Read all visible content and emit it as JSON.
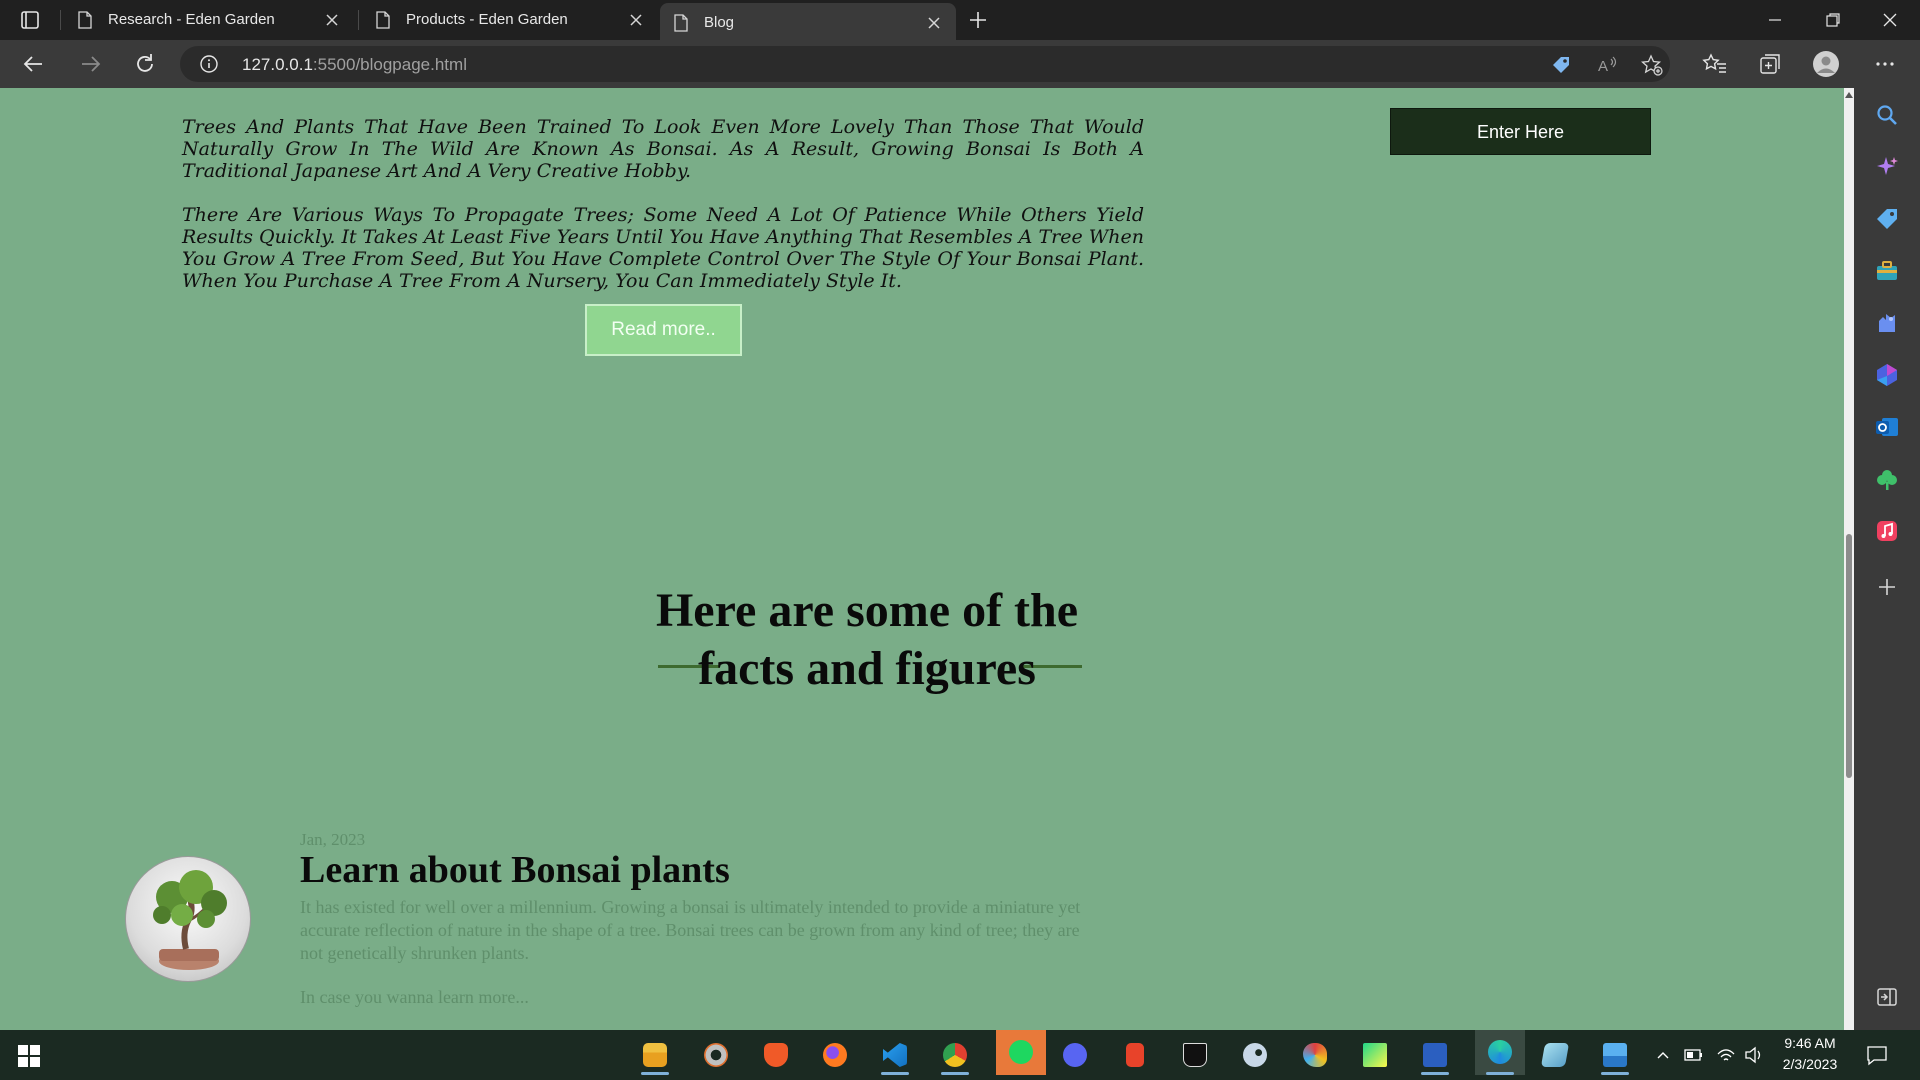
{
  "browser": {
    "tabs": [
      {
        "title": "Research - Eden Garden",
        "active": false
      },
      {
        "title": "Products - Eden Garden",
        "active": false
      },
      {
        "title": "Blog",
        "active": true
      }
    ],
    "address": {
      "host": "127.0.0.1",
      "rest": ":5500/blogpage.html"
    }
  },
  "page": {
    "intro_paragraphs": [
      "Trees And Plants That Have Been Trained To Look Even More Lovely Than Those That Would Naturally Grow In The Wild Are Known As Bonsai. As A Result, Growing Bonsai Is Both A Traditional Japanese Art And A Very Creative Hobby.",
      "There Are Various Ways To Propagate Trees; Some Need A Lot Of Patience While Others Yield Results Quickly. It Takes At Least Five Years Until You Have Anything That Resembles A Tree When You Grow A Tree From Seed, But You Have Complete Control Over The Style Of Your Bonsai Plant. When You Purchase A Tree From A Nursery, You Can Immediately Style It."
    ],
    "read_more_label": "Read more..",
    "enter_label": "Enter Here",
    "facts_heading": "Here are some of the facts and figures",
    "post": {
      "date": "Jan, 2023",
      "title": "Learn about Bonsai plants",
      "body": "It has existed for well over a millennium. Growing a bonsai is ultimately intended to provide a miniature yet accurate reflection of nature in the shape of a tree. Bonsai trees can be grown from any kind of tree; they are not genetically shrunken plants.",
      "more": "In case you wanna learn more..."
    }
  },
  "colors": {
    "page_bg": "#7aad88",
    "accent_button": "#90d690",
    "dark_button": "#1b2e1a",
    "heading_line": "#3d6a2f",
    "muted_text": "#5f8f6b"
  },
  "edge_sidebar": [
    "search-icon",
    "copilot-icon",
    "shopping-tag-icon",
    "tools-icon",
    "games-icon",
    "office-icon",
    "outlook-icon",
    "tree-icon",
    "music-icon",
    "add-icon",
    "hide-sidebar-icon"
  ],
  "taskbar": {
    "apps": [
      "file-explorer-icon",
      "media-player-icon",
      "brave-icon",
      "firefox-icon",
      "vscode-icon",
      "chrome-icon",
      "spotify-icon",
      "discord-icon",
      "office-icon",
      "epic-games-icon",
      "steam-icon",
      "paint-icon",
      "pycharm-icon",
      "word-icon",
      "edge-icon",
      "notepad-icon",
      "photos-icon"
    ],
    "time": "9:46 AM",
    "date": "2/3/2023"
  }
}
